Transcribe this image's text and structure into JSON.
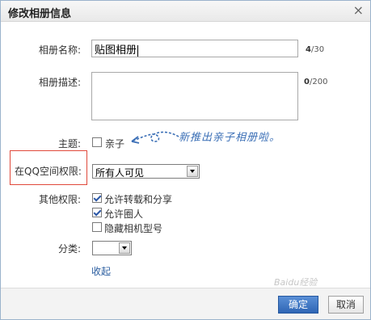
{
  "dialog": {
    "title": "修改相册信息",
    "close_label": "×"
  },
  "form": {
    "name_label": "相册名称:",
    "name_value": "贴图相册",
    "name_count_current": "4",
    "name_count_max": "/30",
    "desc_label": "相册描述:",
    "desc_count_current": "0",
    "desc_count_max": "/200",
    "theme_label": "主题:",
    "theme_option": "亲子",
    "theme_checked": false,
    "perm_label": "在QQ空间权限:",
    "perm_value": "所有人可见",
    "other_perm_label": "其他权限:",
    "other_options": [
      {
        "label": "允许转载和分享",
        "checked": true
      },
      {
        "label": "允许圈人",
        "checked": true
      },
      {
        "label": "隐藏相机型号",
        "checked": false
      }
    ],
    "category_label": "分类:",
    "category_value": "",
    "collapse_link": "收起"
  },
  "annotation": {
    "text": "新推出亲子相册啦。",
    "color": "#3b6fb6"
  },
  "footer": {
    "ok_label": "确定",
    "cancel_label": "取消"
  },
  "watermark": "Baidu经验",
  "colors": {
    "accent": "#2f66b5",
    "highlight_box": "#e0493b",
    "link": "#2a5d9f"
  }
}
